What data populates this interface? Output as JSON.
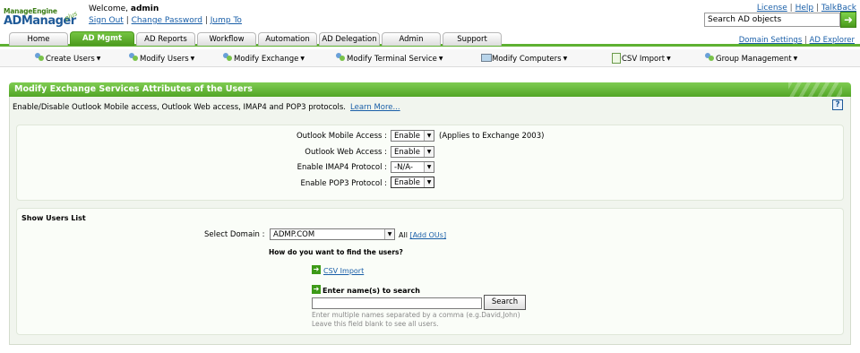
{
  "header": {
    "logo_top": "ManageEngine",
    "logo_main": "ADManager",
    "logo_plus": "plus",
    "welcome_prefix": "Welcome,",
    "username": "admin",
    "sign_out": "Sign Out",
    "change_password": "Change Password",
    "jump_to": "Jump To",
    "sep": "|",
    "license": "License",
    "help": "Help",
    "talkback": "TalkBack",
    "search_value": "Search AD objects",
    "search_go_icon": "arrow-right-icon"
  },
  "tabs": [
    {
      "label": "Home",
      "active": false
    },
    {
      "label": "AD Mgmt",
      "active": true
    },
    {
      "label": "AD Reports",
      "active": false
    },
    {
      "label": "Workflow",
      "active": false
    },
    {
      "label": "Automation",
      "active": false
    },
    {
      "label": "AD Delegation",
      "active": false
    },
    {
      "label": "Admin",
      "active": false
    },
    {
      "label": "Support",
      "active": false
    }
  ],
  "domain_links": {
    "domain_settings": "Domain Settings",
    "ad_explorer": "AD Explorer"
  },
  "submenu": [
    {
      "label": "Create Users",
      "icon": "users-icon"
    },
    {
      "label": "Modify Users",
      "icon": "users-icon"
    },
    {
      "label": "Modify Exchange",
      "icon": "users-icon"
    },
    {
      "label": "Modify Terminal Service",
      "icon": "users-icon"
    },
    {
      "label": "Modify Computers",
      "icon": "computer-icon"
    },
    {
      "label": "CSV Import",
      "icon": "csv-icon"
    },
    {
      "label": "Group Management",
      "icon": "users-icon"
    }
  ],
  "panel": {
    "title": "Modify Exchange Services Attributes of the Users",
    "description": "Enable/Disable Outlook Mobile access, Outlook Web access, IMAP4 and POP3 protocols.",
    "learn_more": "Learn More...",
    "help_icon": "?"
  },
  "attributes": [
    {
      "label": "Outlook Mobile Access :",
      "value": "Enable",
      "note": "(Applies to Exchange 2003)"
    },
    {
      "label": "Outlook Web Access :",
      "value": "Enable",
      "note": ""
    },
    {
      "label": "Enable IMAP4 Protocol :",
      "value": "-N/A-",
      "note": ""
    },
    {
      "label": "Enable POP3 Protocol :",
      "value": "Enable",
      "note": ""
    }
  ],
  "users_list": {
    "heading": "Show Users List",
    "domain_label": "Select Domain :",
    "domain_value": "ADMP.COM",
    "all_label": "All",
    "add_ous": "[Add OUs]",
    "find_question": "How do you want to find the users?",
    "csv_import": "CSV Import",
    "enter_names": "Enter name(s) to search",
    "names_value": "",
    "search_button": "Search",
    "hint_1": "Enter multiple names separated by a comma (e.g.David,John)",
    "hint_2": "Leave this field blank to see all users."
  }
}
